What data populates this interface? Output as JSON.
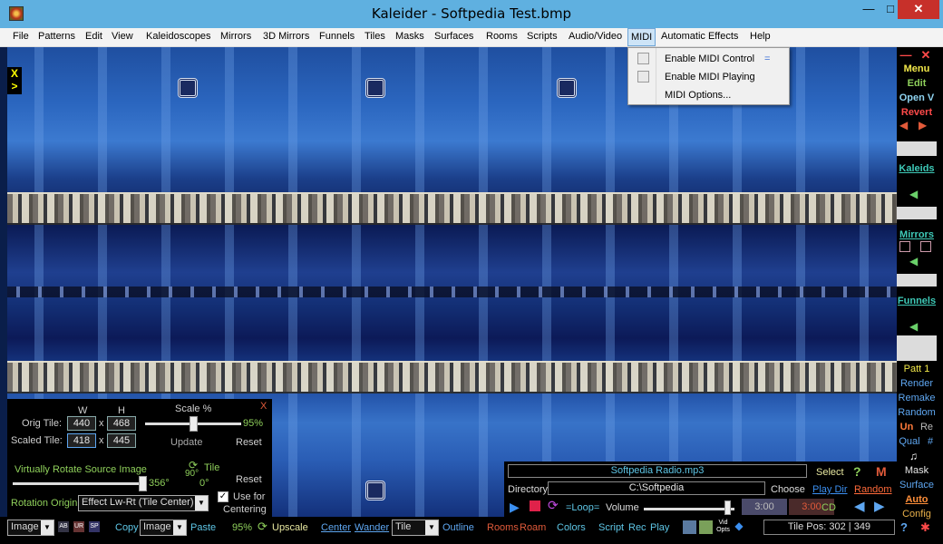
{
  "window": {
    "title": "Kaleider - Softpedia Test.bmp",
    "minimize": "—",
    "maximize": "□",
    "close": "✕"
  },
  "menu": [
    "File",
    "Patterns",
    "Edit",
    "View",
    "Kaleidoscopes",
    "Mirrors",
    "3D Mirrors",
    "Funnels",
    "Tiles",
    "Masks",
    "Surfaces",
    "Rooms",
    "Scripts",
    "Audio/Video",
    "MIDI",
    "Automatic Effects",
    "Help"
  ],
  "midi_menu": {
    "items": [
      {
        "label": "Enable MIDI Control",
        "checked": false,
        "shortcut": "="
      },
      {
        "label": "Enable MIDI Playing",
        "checked": false
      },
      {
        "label": "MIDI Options..."
      }
    ]
  },
  "canvas_corner": {
    "x": "X",
    "arrow": ">"
  },
  "right_panel": {
    "minus": "—",
    "close": "✕",
    "menu": "Menu",
    "edit": "Edit",
    "open": "Open V",
    "revert": "Revert",
    "kaleids": "Kaleids",
    "mirrors": "Mirrors",
    "funnels": "Funnels",
    "patt": "Patt 1",
    "render": "Render",
    "remake": "Remake",
    "random": "Random",
    "un": "Un",
    "re": "Re",
    "qual": "Qual",
    "hash": "#",
    "mask": "Mask",
    "surface": "Surface",
    "auto": "Auto",
    "config": "Config"
  },
  "rotation_panel": {
    "close": "X",
    "w_label": "W",
    "h_label": "H",
    "orig_tile_label": "Orig Tile:",
    "orig_w": "440",
    "orig_h": "468",
    "scaled_tile_label": "Scaled Tile:",
    "scaled_w": "418",
    "scaled_h": "445",
    "times": "x",
    "scale_label": "Scale %",
    "scale_value": "95%",
    "scale_fraction": 0.5,
    "update": "Update",
    "reset": "Reset",
    "rotate_label": "Virtually Rotate Source Image",
    "rotate_value": "356°",
    "rotate_fraction": 0.98,
    "tile_rot_value": "90°",
    "tile_label": "Tile",
    "tile_zero": "0°",
    "reset2": "Reset",
    "origin_label": "Rotation Origin",
    "origin_value": "Effect Lw-Rt (Tile Center)",
    "use_for": "Use for",
    "centering": "Centering",
    "use_for_checked": true
  },
  "audio_panel": {
    "file": "Softpedia Radio.mp3",
    "select": "Select",
    "q": "?",
    "m": "M",
    "directory_label": "Directory",
    "directory": "C:\\Softpedia",
    "choose": "Choose",
    "play_dir": "Play Dir",
    "random": "Random",
    "loop": "=Loop=",
    "volume_label": "Volume",
    "volume_fraction": 0.92,
    "time1": "3:00",
    "time2": "3:00",
    "cd": "CD"
  },
  "bottom_bar": {
    "image1": "Image",
    "ab": "AB",
    "ur": "UR",
    "sr": "SP",
    "copy": "Copy",
    "image2": "Image",
    "paste": "Paste",
    "pct": "95%",
    "upscale": "Upscale",
    "center": "Center",
    "wander": "Wander",
    "tile_select": "Tile",
    "outline": "Outline",
    "rooms": "Rooms",
    "roam": "Roam",
    "colors": "Colors",
    "script": "Script",
    "rec": "Rec",
    "play": "Play",
    "vid_opts": "Vid Opts",
    "tile_pos_label": "Tile Pos:",
    "tile_pos": "302 | 349"
  },
  "colors": {
    "accent": "#5fb0e0",
    "panel": "#000000",
    "link": "#3ec9b7",
    "yellow": "#f2e84a",
    "green": "#8fd05b"
  }
}
